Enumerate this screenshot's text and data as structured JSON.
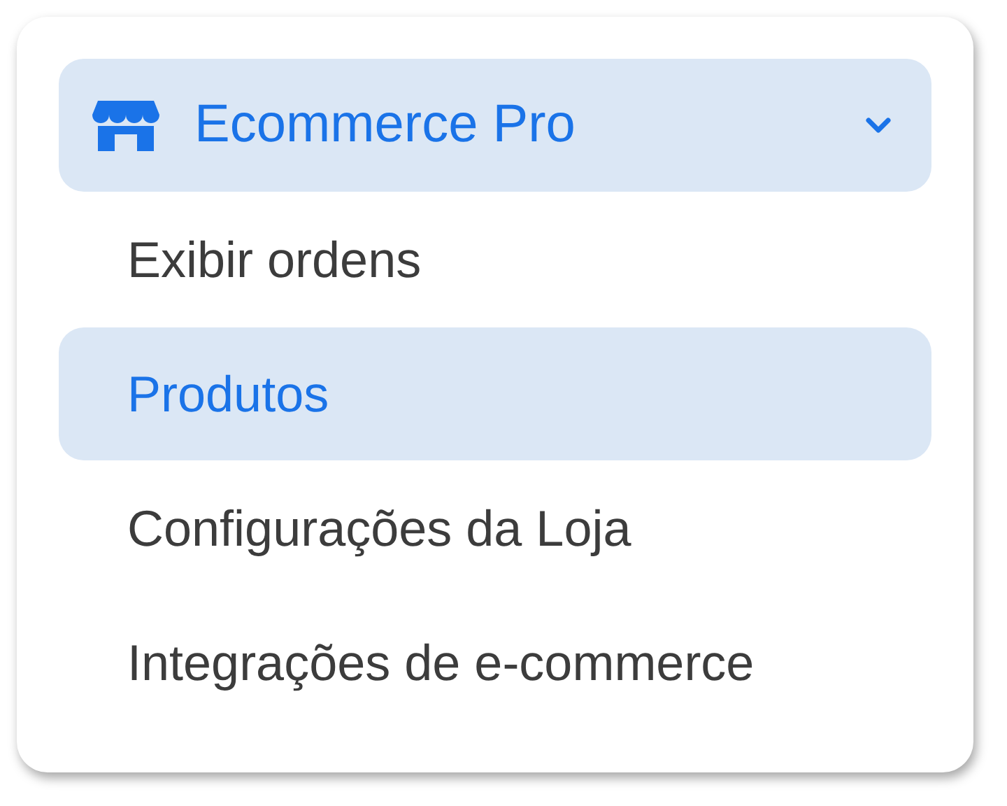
{
  "menu": {
    "title": "Ecommerce Pro",
    "expanded": true,
    "items": [
      {
        "label": "Exibir ordens",
        "selected": false
      },
      {
        "label": "Produtos",
        "selected": true
      },
      {
        "label": "Configurações da Loja",
        "selected": false
      },
      {
        "label": "Integrações de e-commerce",
        "selected": false
      }
    ]
  }
}
